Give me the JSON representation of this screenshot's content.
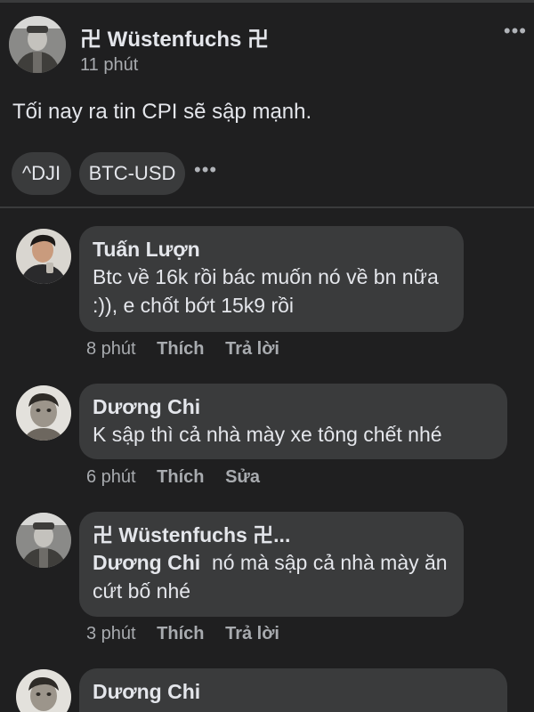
{
  "post": {
    "author": "卍 Wüstenfuchs 卍",
    "time": "11 phút",
    "text": "Tối nay ra tin CPI sẽ sập mạnh.",
    "tags": [
      "^DJI",
      "BTC-USD"
    ],
    "more_icon": "•••"
  },
  "comments": [
    {
      "author": "Tuấn Lượn",
      "text": "Btc về 16k rồi bác muốn nó về bn nữa :)), e chốt bớt 15k9 rồi",
      "time": "8 phút",
      "like": "Thích",
      "action2": "Trả lời"
    },
    {
      "author": "Dương Chi",
      "text": "K sập thì cả nhà mày xe tông chết nhé",
      "time": "6 phút",
      "like": "Thích",
      "action2": "Sửa"
    },
    {
      "author": "卍 Wüstenfuchs 卍...",
      "mention": "Dương Chi",
      "text": "nó mà sập cả nhà mày ăn cứt bố nhé",
      "time": "3 phút",
      "like": "Thích",
      "action2": "Trả lời"
    },
    {
      "author": "Dương Chi"
    }
  ],
  "colors": {
    "background": "#1f1f20",
    "bubble": "#3a3b3c",
    "text": "#e4e6eb",
    "muted": "#a8abaf"
  }
}
